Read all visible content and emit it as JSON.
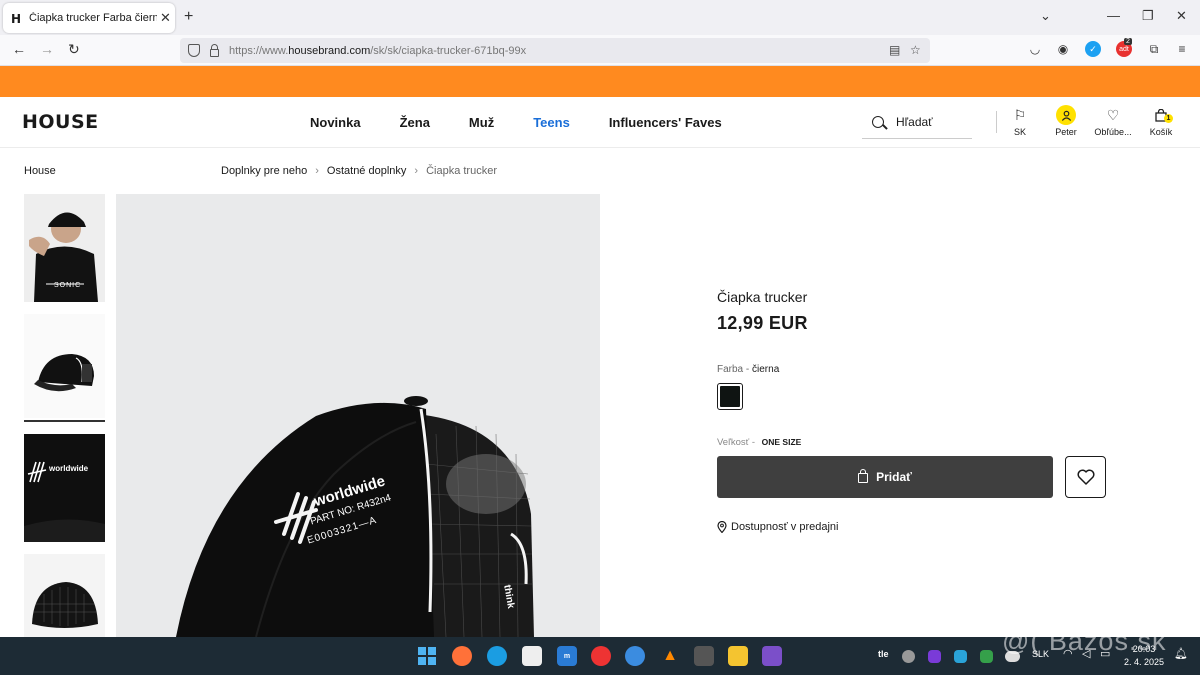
{
  "browser": {
    "tab_title": "Čiapka trucker Farba čierna - H",
    "url_prefix": "https://www.",
    "url_domain": "housebrand.com",
    "url_path": "/sk/sk/ciapka-trucker-671bq-99x",
    "ext_badge": "2"
  },
  "site": {
    "logo": "HOUSE",
    "nav": [
      "Novinka",
      "Žena",
      "Muž",
      "Teens",
      "Influencers' Faves"
    ],
    "nav_active_color": "#1a6ed8",
    "search_label": "Hľadať",
    "header_icons": {
      "country": "SK",
      "account": "Peter",
      "wishlist": "Obľúbe...",
      "cart": "Košík",
      "cart_count": "1"
    }
  },
  "breadcrumb": {
    "home": "House",
    "items": [
      "Doplnky pre neho",
      "Ostatné doplnky",
      "Čiapka trucker"
    ]
  },
  "gallery": {
    "thumb1_text": "SONIC",
    "thumb3_text": "worldwide",
    "main_cap_text_1": "worldwide",
    "main_cap_text_2": "PART NO: R432n4",
    "main_cap_text_3": "E0003321—A",
    "main_cap_side": "think"
  },
  "product": {
    "name": "Čiapka trucker",
    "price": "12,99 EUR",
    "color_label": "Farba - ",
    "color_value": "čierna",
    "swatch_color": "#0f1412",
    "size_label": "Veľkosť - ",
    "size_value": "ONE SIZE",
    "add_label": "Pridať",
    "availability": "Dostupnosť v predajni"
  },
  "taskbar": {
    "tray_text": "tle",
    "lang": "SLK",
    "time": "20:03",
    "date": "2. 4. 2025"
  },
  "watermark": "@( Bazos.sk",
  "colors": {
    "banner": "#ff8a1f",
    "button": "#3f3f3f",
    "taskbar": "#1d2b35"
  }
}
